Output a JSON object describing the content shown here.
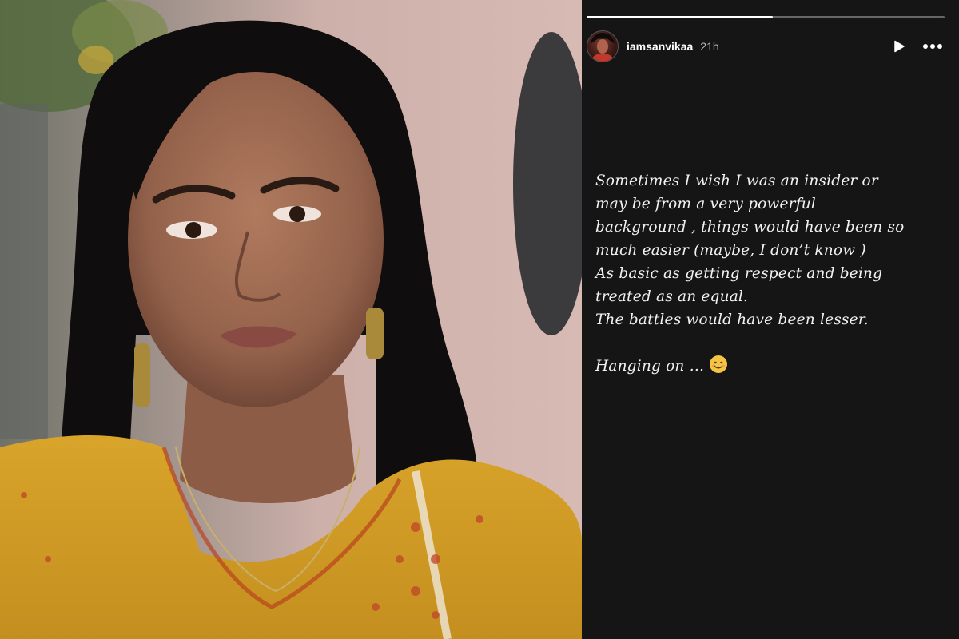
{
  "story": {
    "username": "iamsanvikaa",
    "time_ago": "21h",
    "progress": 0.52,
    "text_lines": [
      "Sometimes I wish I was an insider or",
      "may be from a very powerful",
      "background , things would have been so",
      "much easier (maybe, I don’t know )",
      "As basic as getting respect and being",
      "treated as an equal.",
      "The battles would have been lesser."
    ],
    "closing_line": "Hanging on …",
    "closing_emoji": "smiling-face-icon"
  },
  "colors": {
    "story_background": "#151515",
    "kurta_yellow": "#d9a42a",
    "wall_pink": "#cfada6"
  },
  "icons": {
    "play": "play-icon",
    "more": "more-options-icon"
  }
}
